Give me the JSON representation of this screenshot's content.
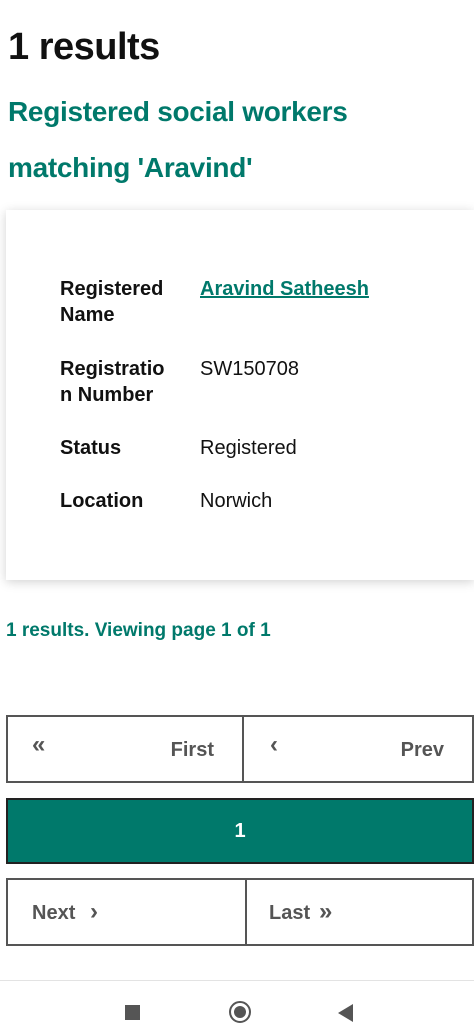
{
  "results_heading": "1 results",
  "subheading": "Registered social workers matching 'Aravind'",
  "record": {
    "name_label": "Registered Name",
    "name_value": "Aravind Satheesh",
    "regno_label": "Registration Number",
    "regno_value": "SW150708",
    "status_label": "Status",
    "status_value": "Registered",
    "location_label": "Location",
    "location_value": "Norwich"
  },
  "summary": "1 results. Viewing page 1 of 1",
  "pagination": {
    "first_label": "First",
    "first_icon": "double-chevron-left-icon",
    "prev_label": "Prev",
    "prev_icon": "chevron-left-icon",
    "current_page": "1",
    "next_label": "Next",
    "next_icon": "chevron-right-icon",
    "last_label": "Last",
    "last_icon": "double-chevron-right-icon"
  },
  "colors": {
    "accent": "#00796b",
    "text": "#111111",
    "button_border": "#555555"
  },
  "system_nav": {
    "recents_icon": "square-icon",
    "home_icon": "circle-icon",
    "back_icon": "triangle-back-icon"
  }
}
